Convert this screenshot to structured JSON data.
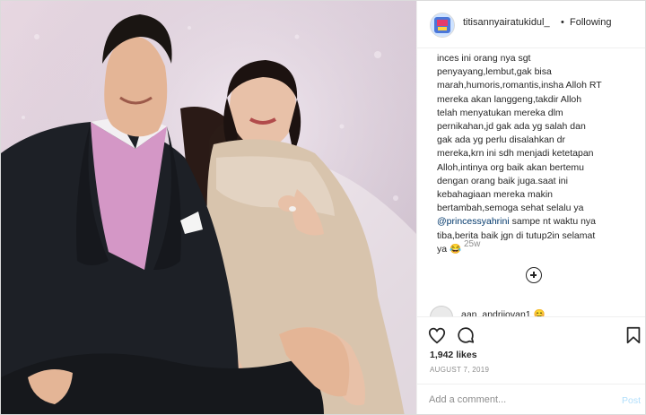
{
  "post": {
    "image_alt": "photo",
    "user": {
      "username": "titisannyairatukidul_",
      "separator": "•",
      "follow_status": "Following"
    },
    "comment": {
      "text_before": "inces ini orang nya sgt\npenyayang,lembut,gak bisa\nmarah,humoris,romantis,insha Alloh RT\nmereka akan langgeng,takdir Alloh\ntelah menyatukan mereka dlm\npernikahan,jd gak ada yg salah dan\ngak ada yg perlu disalahkan dr\nmereka,krn ini sdh menjadi ketetapan\nAlloh,intinya org baik akan bertemu\ndengan orang baik juga.saat ini\nkebahagiaan mereka makin\nbertambah,semoga sehat selalu ya\n",
      "mention": "@princessyahrini",
      "text_after": " sampe nt waktu nya\ntiba,berita baik jgn di tutup2in selamat\nya 😂",
      "time_ago": "25w"
    },
    "next_comment": {
      "username": "aan_andrijovan1 😊"
    },
    "likes": "1,942 likes",
    "date": "AUGUST 7, 2019",
    "add_comment": {
      "placeholder": "Add a comment...",
      "post_label": "Post"
    },
    "icons": [
      "heart-icon",
      "comment-icon",
      "bookmark-icon",
      "plus-circle-icon"
    ],
    "colors": {
      "text": "#262626",
      "muted": "#8e8e8e",
      "link": "#00376b",
      "post_disabled": "#b2dffc",
      "border": "#efefef"
    }
  }
}
